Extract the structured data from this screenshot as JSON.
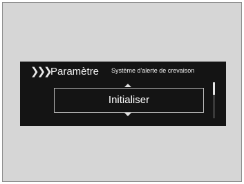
{
  "header": {
    "breadcrumb_icon": "triple-chevron-right",
    "title": "Paramètre",
    "subtitle": "Système d'alerte de crevaison"
  },
  "option": {
    "label": "Initialiser",
    "up_icon": "arrow-up-icon",
    "down_icon": "arrow-down-icon"
  },
  "colors": {
    "screen_background": "#141414",
    "text": "#f2f2f2",
    "frame": "#d6d6d6"
  }
}
